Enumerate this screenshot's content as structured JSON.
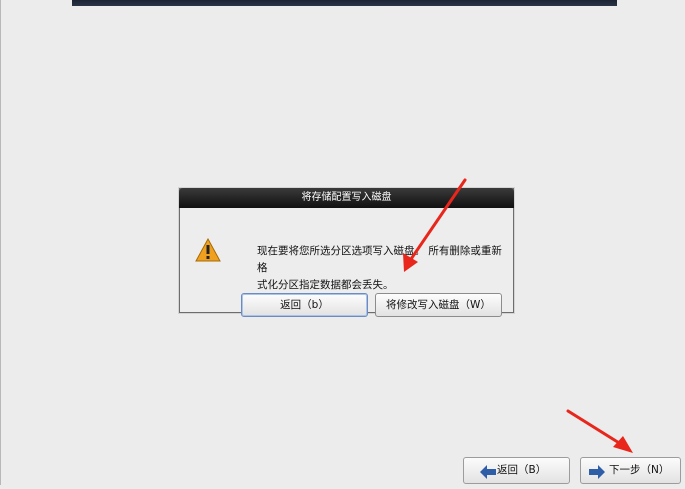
{
  "dialog": {
    "title": "将存储配置写入磁盘",
    "message": "现在要将您所选分区选项写入磁盘。 所有删除或重新格\n式化分区指定数据都会丢失。",
    "back_button": "返回（b）",
    "write_button": "将修改写入磁盘（W）",
    "icon": "warning-icon"
  },
  "nav": {
    "back_label": "返回（B）",
    "next_label": "下一步（N）",
    "back_icon": "arrow-left-icon",
    "next_icon": "arrow-right-icon"
  },
  "colors": {
    "annotation": "#e8261b",
    "title_bar": "#1a1a1a",
    "warning": "#f0a020"
  }
}
